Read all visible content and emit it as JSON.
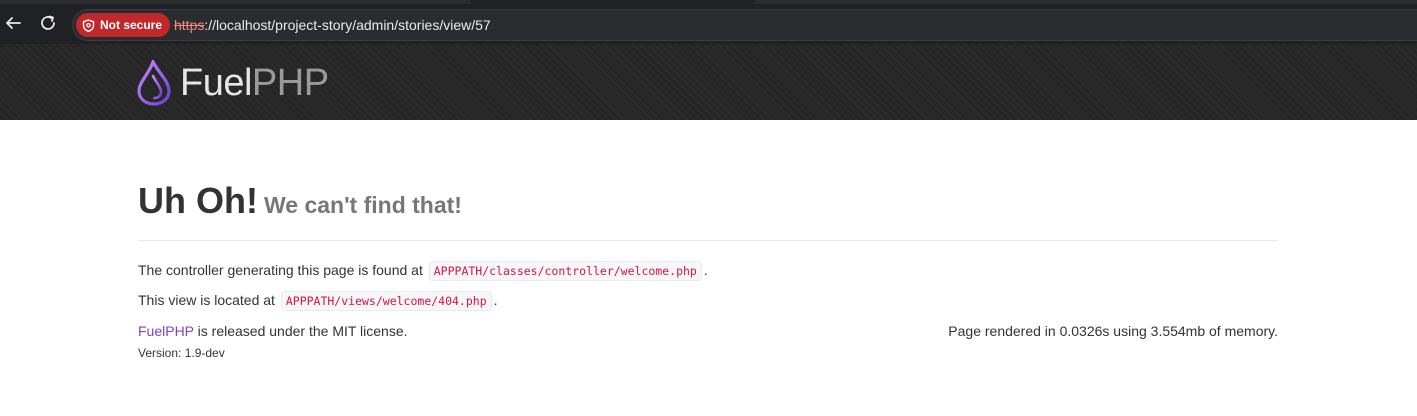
{
  "browser": {
    "security_label": "Not secure",
    "url_scheme": "https",
    "url_rest": "://localhost/project-story/admin/stories/view/57",
    "back_icon": "arrow-left-icon",
    "reload_icon": "reload-icon",
    "security_icon": "shield-warning-icon",
    "colors": {
      "chrome_bg": "#202124",
      "security_chip": "#c1282b"
    }
  },
  "header": {
    "logo_icon": "fuel-drop-icon",
    "logo_text_fuel": "Fuel",
    "logo_text_php": "PHP",
    "colors": {
      "drop_gradient_start": "#b36cf5",
      "drop_gradient_end": "#6d3fd9"
    }
  },
  "main": {
    "title": "Uh Oh!",
    "subtitle": "We can't find that!",
    "controller_text": "The controller generating this page is found at",
    "controller_path": "APPPATH/classes/controller/welcome.php",
    "view_text": "This view is located at",
    "view_path": "APPPATH/views/welcome/404.php",
    "period": "."
  },
  "footer": {
    "link_text": "FuelPHP",
    "license_text": "is released under the MIT license.",
    "render_info": "Page rendered in 0.0326s using 3.554mb of memory.",
    "version": "Version: 1.9-dev"
  }
}
